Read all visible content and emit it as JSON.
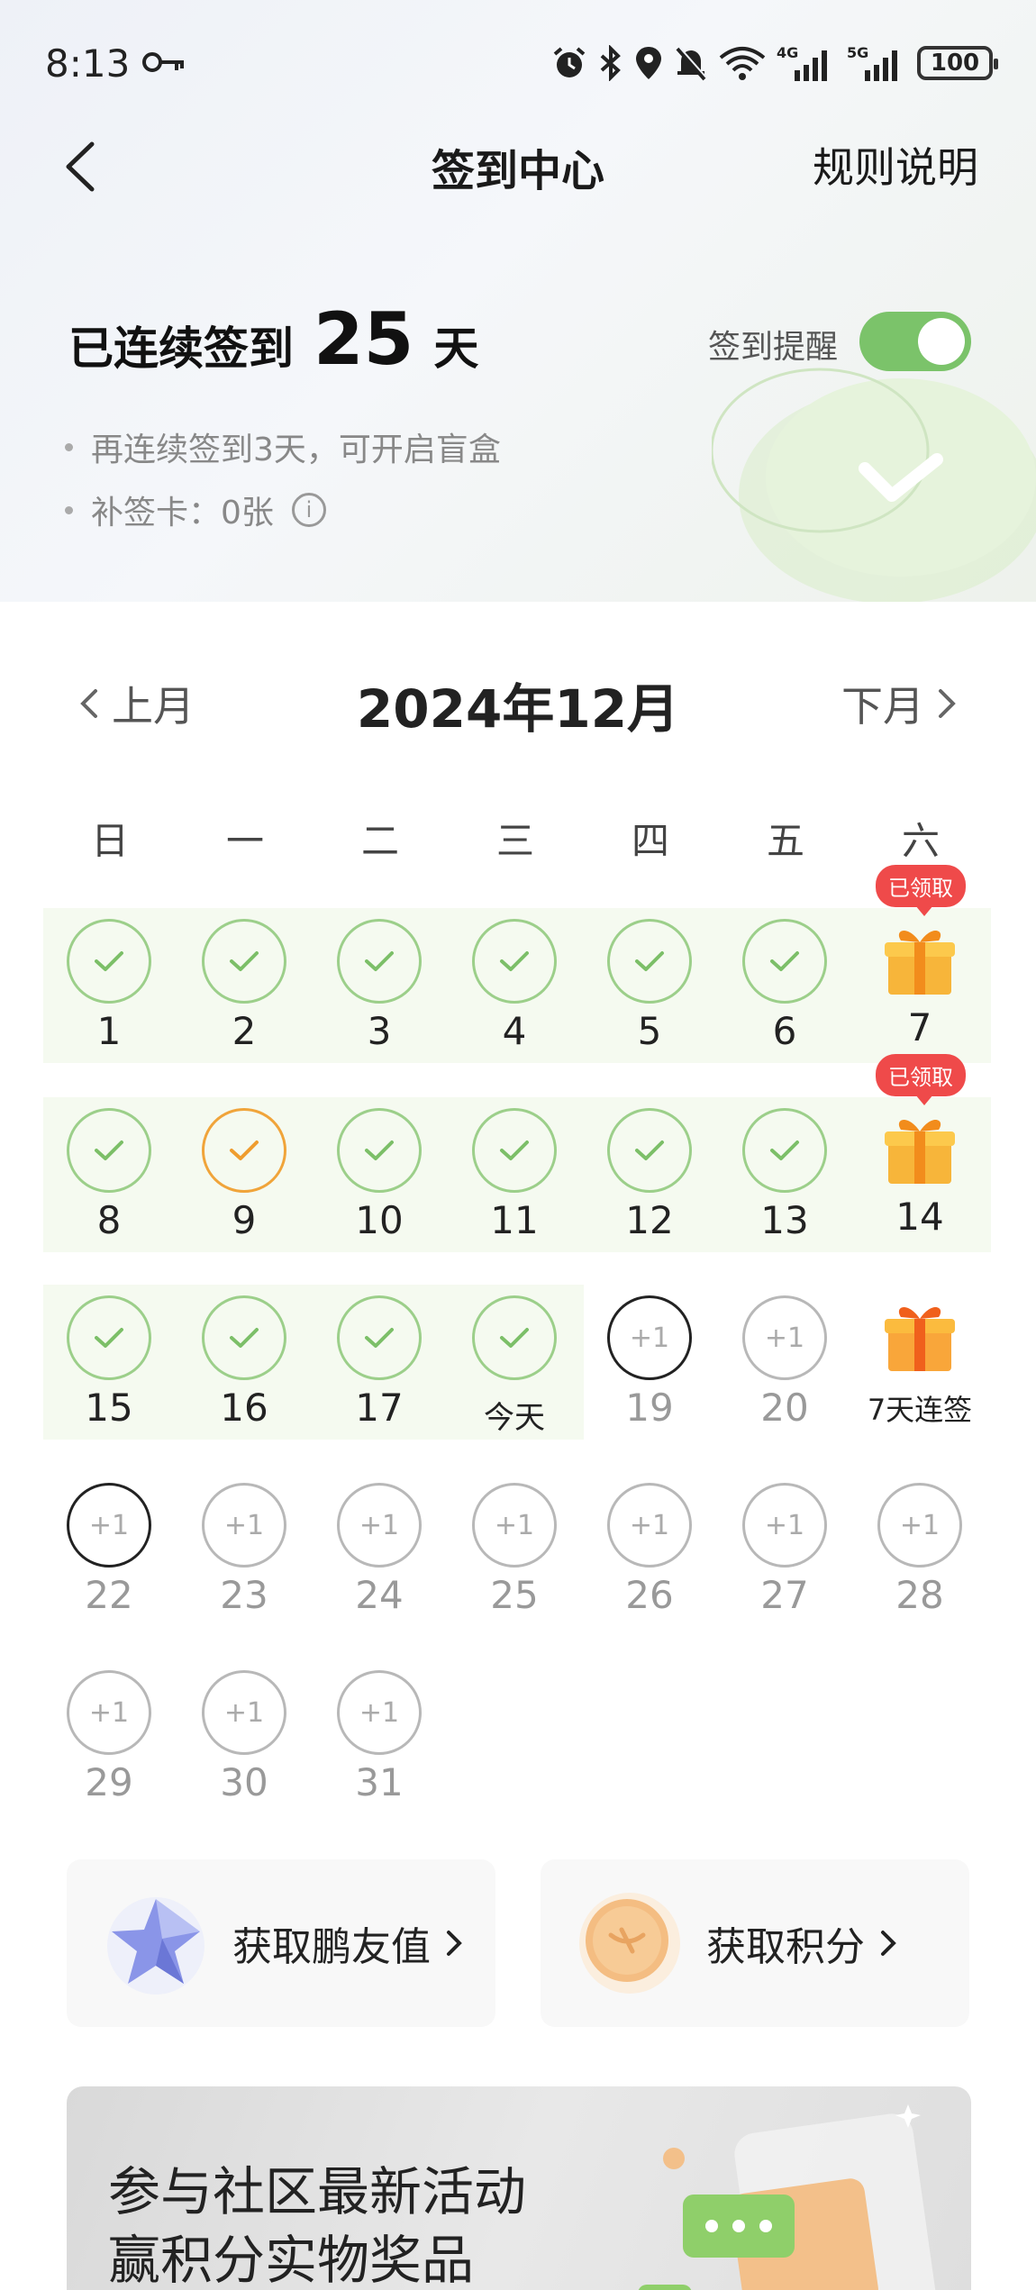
{
  "status_bar": {
    "time": "8:13",
    "battery": "100",
    "network_4g": "4G",
    "network_5g": "5G"
  },
  "nav": {
    "title": "签到中心",
    "rules": "规则说明"
  },
  "streak": {
    "prefix": "已连续签到",
    "days": "25",
    "suffix": "天"
  },
  "reminder": {
    "label": "签到提醒",
    "enabled": true,
    "accent": "#7bc36a"
  },
  "tips": {
    "blind_box": "再连续签到3天，可开启盲盒",
    "makeup_card": "补签卡：0张"
  },
  "calendar": {
    "prev": "上月",
    "next": "下月",
    "title": "2024年12月",
    "weekdays": [
      "日",
      "一",
      "二",
      "三",
      "四",
      "五",
      "六"
    ],
    "plus_label": "+1",
    "claimed_label": "已领取",
    "today_label": "今天",
    "seven_day_label": "7天连签",
    "days": {
      "d1": "1",
      "d2": "2",
      "d3": "3",
      "d4": "4",
      "d5": "5",
      "d6": "6",
      "d7": "7",
      "d8": "8",
      "d9": "9",
      "d10": "10",
      "d11": "11",
      "d12": "12",
      "d13": "13",
      "d14": "14",
      "d15": "15",
      "d16": "16",
      "d17": "17",
      "d19": "19",
      "d20": "20",
      "d22": "22",
      "d23": "23",
      "d24": "24",
      "d25": "25",
      "d26": "26",
      "d27": "27",
      "d28": "28",
      "d29": "29",
      "d30": "30",
      "d31": "31"
    }
  },
  "actions": {
    "friend_value": "获取鹏友值",
    "points": "获取积分"
  },
  "banner": {
    "line1": "参与社区最新活动",
    "line2": "赢积分实物奖品"
  }
}
